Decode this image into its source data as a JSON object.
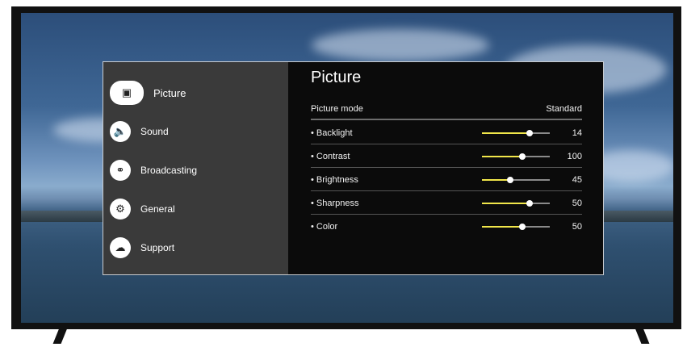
{
  "menu": {
    "categories": [
      {
        "label": "Picture",
        "icon": "picture-icon"
      },
      {
        "label": "Sound",
        "icon": "speaker-icon"
      },
      {
        "label": "Broadcasting",
        "icon": "satellite-icon"
      },
      {
        "label": "General",
        "icon": "wrench-icon"
      },
      {
        "label": "Support",
        "icon": "support-icon"
      }
    ],
    "panel": {
      "title": "Picture",
      "mode_label": "Picture mode",
      "mode_value": "Standard",
      "settings": [
        {
          "label": "• Backlight",
          "value": "14",
          "level": 0.7
        },
        {
          "label": "• Contrast",
          "value": "100",
          "level": 0.6
        },
        {
          "label": "• Brightness",
          "value": "45",
          "level": 0.42
        },
        {
          "label": "• Sharpness",
          "value": "50",
          "level": 0.7
        },
        {
          "label": "• Color",
          "value": "50",
          "level": 0.6
        }
      ]
    }
  },
  "colors": {
    "slider_fill": "#f1e64a",
    "left_panel": "#3a3a3a",
    "right_panel": "#0b0b0b"
  }
}
